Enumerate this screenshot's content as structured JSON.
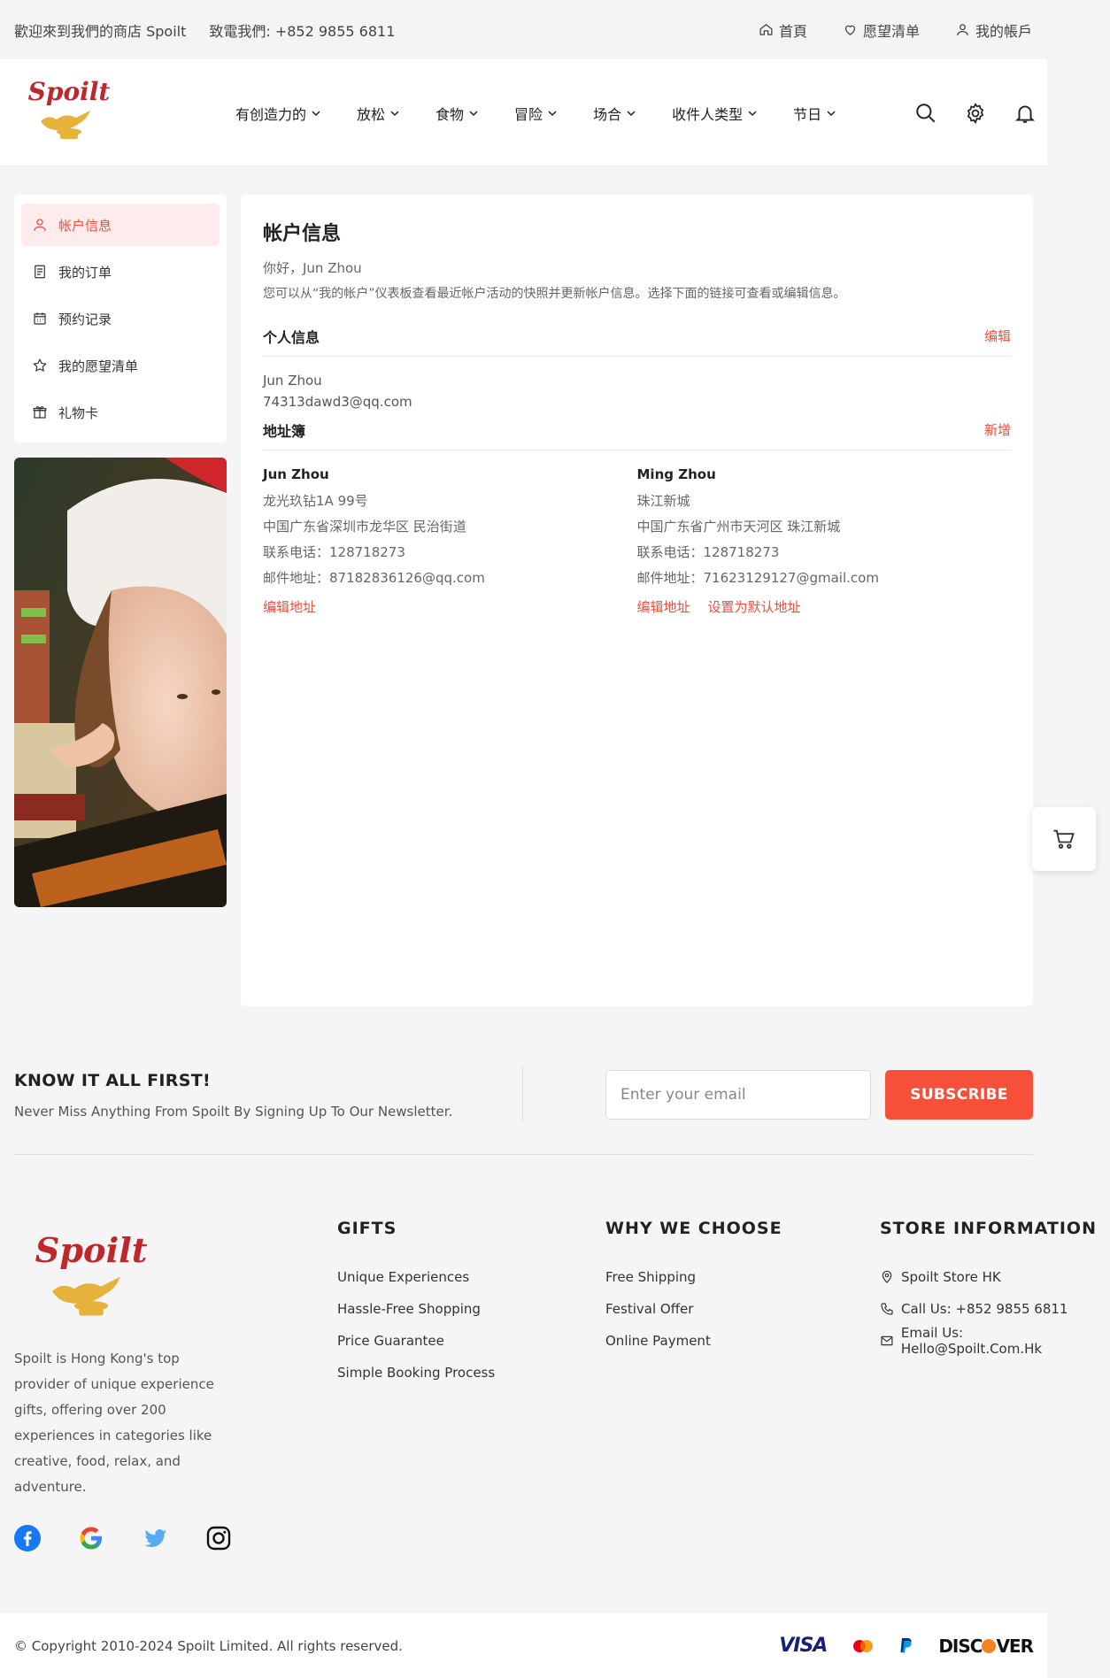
{
  "topbar": {
    "welcome": "歡迎來到我們的商店 Spoilt",
    "phone": "致電我們: +852 9855 6811",
    "home": "首頁",
    "wishlist": "愿望清单",
    "account": "我的帳戶"
  },
  "header": {
    "logo_text": "Spoilt",
    "nav": [
      {
        "label": "有创造力的"
      },
      {
        "label": "放松"
      },
      {
        "label": "食物"
      },
      {
        "label": "冒险"
      },
      {
        "label": "场合"
      },
      {
        "label": "收件人类型"
      },
      {
        "label": "节日"
      }
    ]
  },
  "sidebar": {
    "items": [
      {
        "label": "帐户信息",
        "icon": "user-icon"
      },
      {
        "label": "我的订单",
        "icon": "receipt-icon"
      },
      {
        "label": "预约记录",
        "icon": "calendar-icon"
      },
      {
        "label": "我的愿望清单",
        "icon": "star-icon"
      },
      {
        "label": "礼物卡",
        "icon": "gift-icon"
      }
    ]
  },
  "main": {
    "title": "帐户信息",
    "greeting": "你好，Jun Zhou",
    "intro": "您可以从“我的帐户”仪表板查看最近帐户活动的快照并更新帐户信息。选择下面的链接可查看或编辑信息。",
    "personal": {
      "heading": "个人信息",
      "edit": "编辑",
      "name": "Jun Zhou",
      "email": "74313dawd3@qq.com"
    },
    "addressbook": {
      "heading": "地址簿",
      "add": "新增",
      "addresses": [
        {
          "name": "Jun Zhou",
          "line1": "龙光玖钻1A 99号",
          "line2": "中国广东省深圳市龙华区 民治街道",
          "phone": "联系电话：128718273",
          "email": "邮件地址：87182836126@qq.com",
          "edit": "编辑地址"
        },
        {
          "name": "Ming Zhou",
          "line1": "珠江新城",
          "line2": "中国广东省广州市天河区 珠江新城",
          "phone": "联系电话：128718273",
          "email": "邮件地址：71623129127@gmail.com",
          "edit": "编辑地址",
          "set_default": "设置为默认地址"
        }
      ]
    }
  },
  "newsletter": {
    "title": "KNOW IT ALL FIRST!",
    "subtitle": "Never Miss Anything From Spoilt By Signing Up To Our Newsletter.",
    "placeholder": "Enter your email",
    "button": "SUBSCRIBE"
  },
  "footer": {
    "about": "Spoilt is Hong Kong's top provider of unique experience gifts, offering over 200 experiences in categories like creative, food, relax, and adventure.",
    "gifts": {
      "heading": "GIFTS",
      "links": [
        "Unique Experiences",
        "Hassle-Free Shopping",
        "Price Guarantee",
        "Simple Booking Process"
      ]
    },
    "why": {
      "heading": "WHY WE CHOOSE",
      "links": [
        "Free Shipping",
        "Festival Offer",
        "Online Payment"
      ]
    },
    "store": {
      "heading": "STORE INFORMATION",
      "name": "Spoilt Store HK",
      "phone": "Call Us: +852 9855 6811",
      "email": "Email Us: Hello@Spoilt.Com.Hk"
    },
    "copyright": "© Copyright 2010-2024 Spoilt Limited. All rights reserved.",
    "payments": {
      "visa": "VISA",
      "discover_a": "DISC",
      "discover_b": "VER"
    }
  },
  "colors": {
    "accent": "#f04e3e",
    "subscribe": "#f6503b",
    "logo_red": "#c0272d",
    "logo_gold": "#e6b23a"
  }
}
